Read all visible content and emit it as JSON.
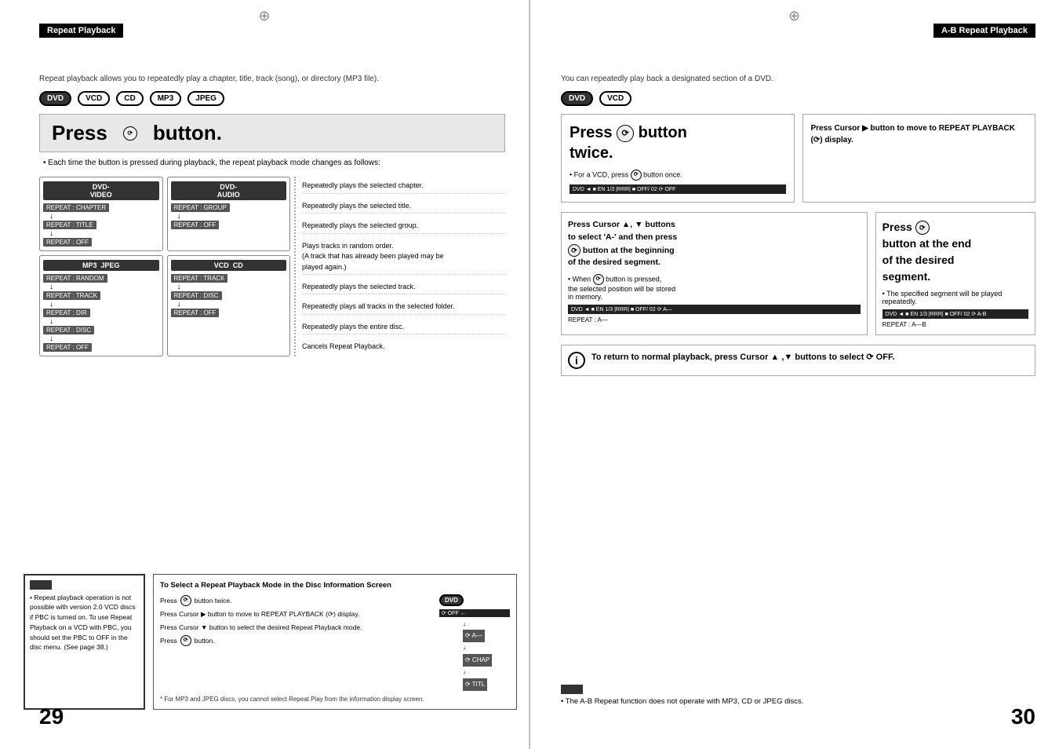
{
  "pages": {
    "left": {
      "number": "29",
      "title_box": "Repeat Playback",
      "intro": "Repeat playback allows you to repeatedly play a chapter, title, track (song), or directory (MP3 file).",
      "formats": [
        "DVD",
        "VCD",
        "CD",
        "MP3",
        "JPEG"
      ],
      "heading_press": "Press",
      "heading_button": "button.",
      "subtext": "• Each time the button is pressed during playback, the repeat playback mode changes as follows:",
      "dvd_video_label": "DVD-VIDEO",
      "dvd_audio_label": "DVD-AUDIO",
      "mp3_jpeg_label": "MP3  JPEG",
      "vcd_cd_label": "VCD  CD",
      "dvd_video_modes": [
        "REPEAT : CHAPTER",
        "REPEAT : TITLE",
        "REPEAT : OFF"
      ],
      "dvd_audio_modes": [
        "REPEAT : GROUP",
        "REPEAT : OFF"
      ],
      "mp3_jpeg_modes": [
        "REPEAT : RANDOM",
        "REPEAT : TRACK",
        "REPEAT : DIR",
        "REPEAT : DISC",
        "REPEAT : OFF"
      ],
      "vcd_cd_modes": [
        "REPEAT : TRACK",
        "REPEAT : DISC",
        "REPEAT : OFF"
      ],
      "descriptions": [
        "Repeatedly plays the selected chapter.",
        "Repeatedly plays the selected title.",
        "Repeatedly plays the selected group.",
        "Plays tracks in random order.\n(A track that has already been played may be\nplayed again.)",
        "Repeatedly plays the selected track.",
        "Repeatedly plays all tracks in the selected folder.",
        "Repeatedly plays the entire disc.",
        "Cancels Repeat Playback."
      ],
      "note_header": "",
      "note_text": "• Repeat playback operation is not possible with version 2.0 VCD discs if PBC is turned on. To use Repeat Playback on a VCD with PBC, you should set the PBC to OFF in the disc menu. (See page 38.)",
      "disc_info_title": "To Select a Repeat Playback Mode in the Disc Information Screen",
      "disc_steps": [
        "Press    button twice.",
        "Press Cursor ▶ button to move to REPEAT PLAYBACK (⟳) display.",
        "Press Cursor ▼ button to select the desired Repeat Playback mode.",
        "Press    button."
      ],
      "disc_note": "* For MP3 and JPEG discs, you cannot select Repeat Play from the information display screen.",
      "disc_diagram_items": [
        "⟳ OFF",
        "⟳ A—",
        "⟳ CHAP",
        "⟳ TITL"
      ]
    },
    "right": {
      "number": "30",
      "title_box": "A-B Repeat Playback",
      "intro": "You can repeatedly play back a designated section of a DVD.",
      "formats": [
        "DVD",
        "VCD"
      ],
      "press_twice_heading1": "Press",
      "press_twice_heading2": "button",
      "press_twice_heading3": "twice.",
      "vcd_note": "• For a VCD, press    button once.",
      "cursor_button_heading": "Press Cursor ▶ button to move to REPEAT PLAYBACK (⟳) display.",
      "ab_left_heading1": "Press Cursor ▲, ▼ buttons to select 'A-' and then press    button at the beginning of the desired segment.",
      "ab_left_note": "• When    button is pressed, the selected position will be stored in memory.",
      "ab_right_heading": "Press    button at the end of the desired segment.",
      "ab_right_note": "• The specified segment will be played repeatedly.",
      "status_bars": {
        "dvd_off": "DVD  ◄  ■  EN 1/3  |RRRR|  ■  OFF/ 02  ⟳ OFF",
        "dvd_a": "DVD  ◄  ■  EN 1/3  |RRRR|  ■  OFF/ 02  ⟳ A—",
        "dvd_ab": "DVD  ◄  ■  EN 1/3  |RRRR|  ■  OFF/ 02  ⟳ A-B",
        "repeat_ab": "REPEAT : A—B",
        "repeat_a": "REPEAT : A—"
      },
      "return_to_normal": "To return to normal playback, press Cursor ▲ ,▼ buttons to select ⟳ OFF.",
      "bottom_note_header": "",
      "bottom_note_text": "• The A-B Repeat function does not operate with MP3, CD or JPEG discs."
    }
  }
}
